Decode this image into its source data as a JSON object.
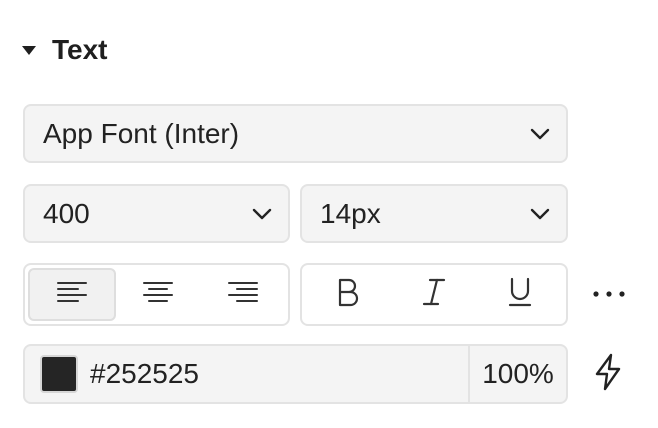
{
  "section": {
    "title": "Text",
    "expanded": true
  },
  "font": {
    "selected": "App Font (Inter)"
  },
  "weight": {
    "selected": "400"
  },
  "size": {
    "selected": "14px"
  },
  "alignment": {
    "options": [
      "align-left",
      "align-center",
      "align-right"
    ],
    "active": "align-left"
  },
  "style_toggles": [
    "bold",
    "italic",
    "underline"
  ],
  "color": {
    "hex": "#252525",
    "swatch": "#252525",
    "opacity": "100%"
  },
  "icons": {
    "more": "more-icon",
    "token": "lightning-bolt-icon"
  }
}
